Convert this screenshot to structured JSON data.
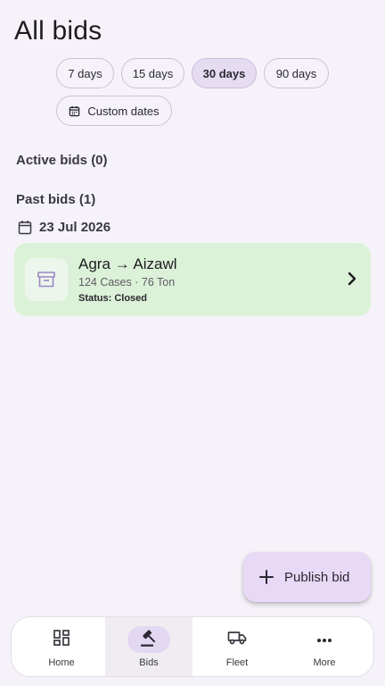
{
  "header": {
    "title": "All bids"
  },
  "filters": {
    "chips": [
      {
        "label": "7 days",
        "selected": false
      },
      {
        "label": "15 days",
        "selected": false
      },
      {
        "label": "30 days",
        "selected": true
      },
      {
        "label": "90 days",
        "selected": false
      }
    ],
    "custom_dates": {
      "label": "Custom dates",
      "icon": "calendar-icon"
    }
  },
  "sections": {
    "active_label": "Active bids (0)",
    "past_label": "Past bids (1)"
  },
  "past_bids": {
    "date": "23 Jul 2026",
    "items": [
      {
        "route": "Agra → Aizawl",
        "meta": "124 Cases · 76 Ton",
        "status": "Status: Closed",
        "icon": "archive-icon"
      }
    ]
  },
  "fab": {
    "label": "Publish bid",
    "icon": "plus-icon"
  },
  "bottom_nav": {
    "items": [
      {
        "label": "Home",
        "icon": "home-grid-icon",
        "active": false
      },
      {
        "label": "Bids",
        "icon": "gavel-icon",
        "active": true
      },
      {
        "label": "Fleet",
        "icon": "truck-icon",
        "active": false
      },
      {
        "label": "More",
        "icon": "more-dots-icon",
        "active": false
      }
    ]
  },
  "colors": {
    "background": "#f6f2f9",
    "selected_chip": "#e5dcf1",
    "bid_card": "#dcf2d8",
    "fab": "#e8d9f6",
    "nav_active": "#e2d8f2"
  }
}
